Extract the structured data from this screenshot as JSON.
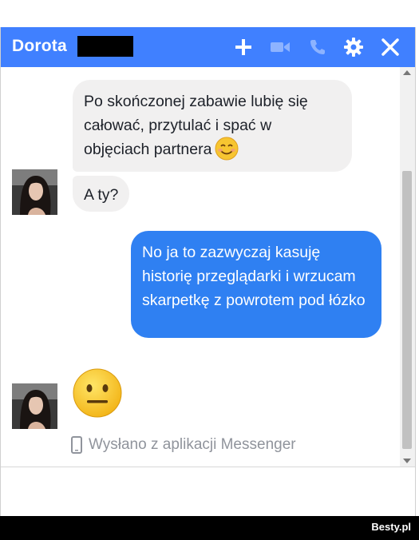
{
  "chat": {
    "title": "Dorota",
    "header_icons": [
      "add-icon",
      "video-call-icon",
      "phone-icon",
      "gear-icon",
      "close-icon"
    ],
    "accent_color": "#4080ff",
    "messages": {
      "incoming_1": "Po skończonej zabawie lubię się całować, przytulać i spać w objęciach partnera",
      "incoming_1_emoji": "smiling-face-emoji",
      "incoming_2": "A ty?",
      "outgoing_1": "No ja to zazwyczaj kasuję historię przeglądarki i wrzucam skarpetkę z powrotem pod łózko",
      "incoming_3_emoji": "neutral-face-emoji"
    },
    "sent_from": "Wysłano z aplikacji Messenger"
  },
  "footer": {
    "brand": "Besty.pl"
  }
}
